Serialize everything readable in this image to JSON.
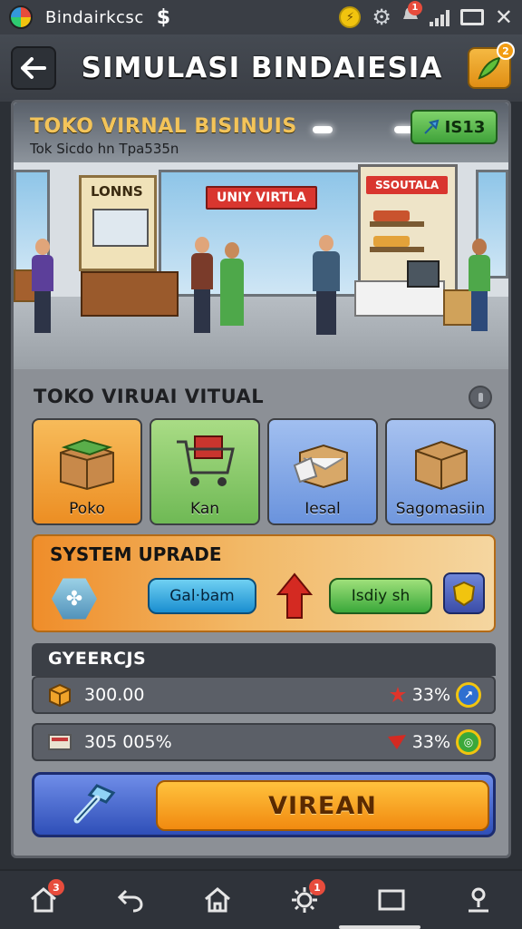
{
  "status_bar": {
    "app_name": "Bindairkcsc",
    "currency_symbol": "$",
    "notification_count": "1"
  },
  "header": {
    "title": "SIMULASI BINDAIESIA",
    "feather_badge": "2"
  },
  "store": {
    "title": "TOKO VIRNAL BISINUIS",
    "subtitle": "Tok Sicdo hn Tpa535n",
    "badge_value": "IS13",
    "signs": {
      "left": "LONNS",
      "center": "UNIY VIRTLA",
      "right": "SSOUTALA"
    }
  },
  "section": {
    "label": "TOKO VIRUAI VITUAL"
  },
  "cards": [
    {
      "label": "Poko",
      "color": "#f2a13a"
    },
    {
      "label": "Kan",
      "color": "#8fcf6e"
    },
    {
      "label": "Iesal",
      "color": "#7ea6e8"
    },
    {
      "label": "Sagomasiin",
      "color": "#8eaee8"
    }
  ],
  "upgrade": {
    "title": "SYSTEM UPRADE",
    "btn_blue": "Gal·bam",
    "btn_green": "Isdiy sh"
  },
  "stats": {
    "header": "GYEERCJS",
    "rows": [
      {
        "value": "300.00",
        "pct": "33%"
      },
      {
        "value": "305 005%",
        "pct": "33%"
      }
    ]
  },
  "action": {
    "label": "VIREAN"
  },
  "bottom_nav": {
    "home_badge": "3",
    "settings_badge": "1"
  }
}
